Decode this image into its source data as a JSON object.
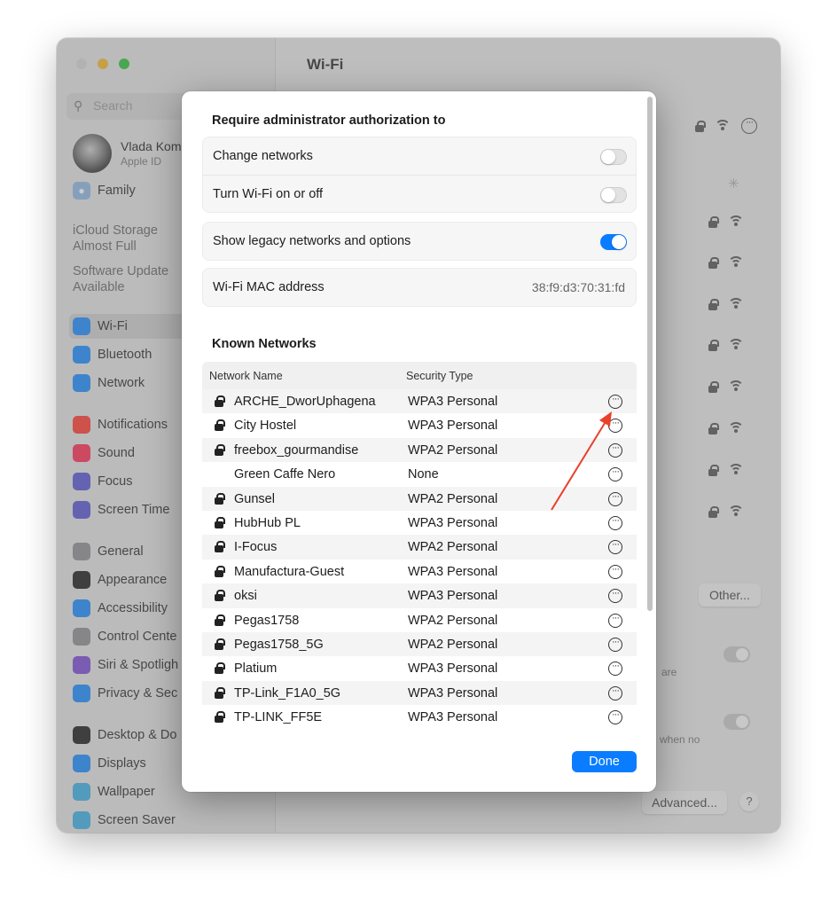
{
  "window": {
    "title": "Wi-Fi"
  },
  "sidebar": {
    "search_placeholder": "Search",
    "profile_name": "Vlada Kom",
    "profile_sub": "Apple ID",
    "family": "Family",
    "icloud_notice": [
      "iCloud Storage",
      "Almost Full"
    ],
    "update_notice": [
      "Software Update",
      "Available"
    ],
    "items": [
      {
        "label": "Wi-Fi",
        "icon": "wifi-icon",
        "color": "#1a8cff"
      },
      {
        "label": "Bluetooth",
        "icon": "bluetooth-icon",
        "color": "#1a8cff"
      },
      {
        "label": "Network",
        "icon": "globe-icon",
        "color": "#1a8cff"
      },
      {
        "label": "Notifications",
        "icon": "bell-icon",
        "color": "#ff3b30"
      },
      {
        "label": "Sound",
        "icon": "speaker-icon",
        "color": "#ff2d55"
      },
      {
        "label": "Focus",
        "icon": "moon-icon",
        "color": "#5856d6"
      },
      {
        "label": "Screen Time",
        "icon": "hourglass-icon",
        "color": "#5856d6"
      },
      {
        "label": "General",
        "icon": "gear-icon",
        "color": "#8e8e93"
      },
      {
        "label": "Appearance",
        "icon": "appearance-icon",
        "color": "#1c1c1e"
      },
      {
        "label": "Accessibility",
        "icon": "accessibility-icon",
        "color": "#1a8cff"
      },
      {
        "label": "Control Cente",
        "icon": "control-center-icon",
        "color": "#8e8e93"
      },
      {
        "label": "Siri & Spotligh",
        "icon": "siri-icon",
        "color": "#7b4bd6"
      },
      {
        "label": "Privacy & Sec",
        "icon": "hand-icon",
        "color": "#1a8cff"
      },
      {
        "label": "Desktop & Do",
        "icon": "desktop-icon",
        "color": "#1c1c1e"
      },
      {
        "label": "Displays",
        "icon": "sun-icon",
        "color": "#1a8cff"
      },
      {
        "label": "Wallpaper",
        "icon": "flower-icon",
        "color": "#3ab0e6"
      },
      {
        "label": "Screen Saver",
        "icon": "screensaver-icon",
        "color": "#3ab0e6"
      }
    ]
  },
  "background_pane": {
    "other_button": "Other...",
    "advanced_button": "Advanced...",
    "help_button": "?",
    "fragment_are": "are",
    "fragment_when_no": "when no"
  },
  "sheet": {
    "require_heading": "Require administrator authorization to",
    "change_networks": "Change networks",
    "change_networks_on": false,
    "turn_wifi": "Turn Wi-Fi on or off",
    "turn_wifi_on": false,
    "legacy": "Show legacy networks and options",
    "legacy_on": true,
    "mac_label": "Wi-Fi MAC address",
    "mac_value": "38:f9:d3:70:31:fd",
    "known_heading": "Known Networks",
    "col_name": "Network Name",
    "col_security": "Security Type",
    "networks": [
      {
        "name": "ARCHE_DworUphagena",
        "security": "WPA3 Personal",
        "locked": true
      },
      {
        "name": "City Hostel",
        "security": "WPA3 Personal",
        "locked": true
      },
      {
        "name": "freebox_gourmandise",
        "security": "WPA2 Personal",
        "locked": true
      },
      {
        "name": "Green Caffe Nero",
        "security": "None",
        "locked": false
      },
      {
        "name": "Gunsel",
        "security": "WPA2 Personal",
        "locked": true
      },
      {
        "name": "HubHub PL",
        "security": "WPA3 Personal",
        "locked": true
      },
      {
        "name": "I-Focus",
        "security": "WPA2 Personal",
        "locked": true
      },
      {
        "name": "Manufactura-Guest",
        "security": "WPA3 Personal",
        "locked": true
      },
      {
        "name": "oksi",
        "security": "WPA3 Personal",
        "locked": true
      },
      {
        "name": "Pegas1758",
        "security": "WPA2 Personal",
        "locked": true
      },
      {
        "name": "Pegas1758_5G",
        "security": "WPA2 Personal",
        "locked": true
      },
      {
        "name": "Platium",
        "security": "WPA3 Personal",
        "locked": true
      },
      {
        "name": "TP-Link_F1A0_5G",
        "security": "WPA3 Personal",
        "locked": true
      },
      {
        "name": "TP-LINK_FF5E",
        "security": "WPA3 Personal",
        "locked": true
      }
    ],
    "done_button": "Done"
  },
  "colors": {
    "accent": "#0a7cff",
    "annotation_arrow": "#e8412c"
  }
}
